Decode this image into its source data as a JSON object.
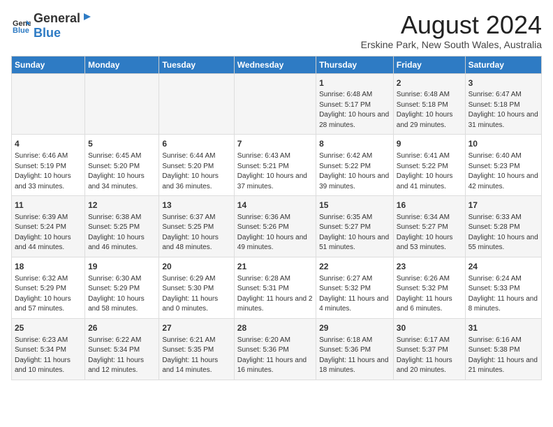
{
  "logo": {
    "text_general": "General",
    "text_blue": "Blue"
  },
  "title": "August 2024",
  "subtitle": "Erskine Park, New South Wales, Australia",
  "days_of_week": [
    "Sunday",
    "Monday",
    "Tuesday",
    "Wednesday",
    "Thursday",
    "Friday",
    "Saturday"
  ],
  "weeks": [
    [
      {
        "day": "",
        "content": ""
      },
      {
        "day": "",
        "content": ""
      },
      {
        "day": "",
        "content": ""
      },
      {
        "day": "",
        "content": ""
      },
      {
        "day": "1",
        "content": "Sunrise: 6:48 AM\nSunset: 5:17 PM\nDaylight: 10 hours and 28 minutes."
      },
      {
        "day": "2",
        "content": "Sunrise: 6:48 AM\nSunset: 5:18 PM\nDaylight: 10 hours and 29 minutes."
      },
      {
        "day": "3",
        "content": "Sunrise: 6:47 AM\nSunset: 5:18 PM\nDaylight: 10 hours and 31 minutes."
      }
    ],
    [
      {
        "day": "4",
        "content": "Sunrise: 6:46 AM\nSunset: 5:19 PM\nDaylight: 10 hours and 33 minutes."
      },
      {
        "day": "5",
        "content": "Sunrise: 6:45 AM\nSunset: 5:20 PM\nDaylight: 10 hours and 34 minutes."
      },
      {
        "day": "6",
        "content": "Sunrise: 6:44 AM\nSunset: 5:20 PM\nDaylight: 10 hours and 36 minutes."
      },
      {
        "day": "7",
        "content": "Sunrise: 6:43 AM\nSunset: 5:21 PM\nDaylight: 10 hours and 37 minutes."
      },
      {
        "day": "8",
        "content": "Sunrise: 6:42 AM\nSunset: 5:22 PM\nDaylight: 10 hours and 39 minutes."
      },
      {
        "day": "9",
        "content": "Sunrise: 6:41 AM\nSunset: 5:22 PM\nDaylight: 10 hours and 41 minutes."
      },
      {
        "day": "10",
        "content": "Sunrise: 6:40 AM\nSunset: 5:23 PM\nDaylight: 10 hours and 42 minutes."
      }
    ],
    [
      {
        "day": "11",
        "content": "Sunrise: 6:39 AM\nSunset: 5:24 PM\nDaylight: 10 hours and 44 minutes."
      },
      {
        "day": "12",
        "content": "Sunrise: 6:38 AM\nSunset: 5:25 PM\nDaylight: 10 hours and 46 minutes."
      },
      {
        "day": "13",
        "content": "Sunrise: 6:37 AM\nSunset: 5:25 PM\nDaylight: 10 hours and 48 minutes."
      },
      {
        "day": "14",
        "content": "Sunrise: 6:36 AM\nSunset: 5:26 PM\nDaylight: 10 hours and 49 minutes."
      },
      {
        "day": "15",
        "content": "Sunrise: 6:35 AM\nSunset: 5:27 PM\nDaylight: 10 hours and 51 minutes."
      },
      {
        "day": "16",
        "content": "Sunrise: 6:34 AM\nSunset: 5:27 PM\nDaylight: 10 hours and 53 minutes."
      },
      {
        "day": "17",
        "content": "Sunrise: 6:33 AM\nSunset: 5:28 PM\nDaylight: 10 hours and 55 minutes."
      }
    ],
    [
      {
        "day": "18",
        "content": "Sunrise: 6:32 AM\nSunset: 5:29 PM\nDaylight: 10 hours and 57 minutes."
      },
      {
        "day": "19",
        "content": "Sunrise: 6:30 AM\nSunset: 5:29 PM\nDaylight: 10 hours and 58 minutes."
      },
      {
        "day": "20",
        "content": "Sunrise: 6:29 AM\nSunset: 5:30 PM\nDaylight: 11 hours and 0 minutes."
      },
      {
        "day": "21",
        "content": "Sunrise: 6:28 AM\nSunset: 5:31 PM\nDaylight: 11 hours and 2 minutes."
      },
      {
        "day": "22",
        "content": "Sunrise: 6:27 AM\nSunset: 5:32 PM\nDaylight: 11 hours and 4 minutes."
      },
      {
        "day": "23",
        "content": "Sunrise: 6:26 AM\nSunset: 5:32 PM\nDaylight: 11 hours and 6 minutes."
      },
      {
        "day": "24",
        "content": "Sunrise: 6:24 AM\nSunset: 5:33 PM\nDaylight: 11 hours and 8 minutes."
      }
    ],
    [
      {
        "day": "25",
        "content": "Sunrise: 6:23 AM\nSunset: 5:34 PM\nDaylight: 11 hours and 10 minutes."
      },
      {
        "day": "26",
        "content": "Sunrise: 6:22 AM\nSunset: 5:34 PM\nDaylight: 11 hours and 12 minutes."
      },
      {
        "day": "27",
        "content": "Sunrise: 6:21 AM\nSunset: 5:35 PM\nDaylight: 11 hours and 14 minutes."
      },
      {
        "day": "28",
        "content": "Sunrise: 6:20 AM\nSunset: 5:36 PM\nDaylight: 11 hours and 16 minutes."
      },
      {
        "day": "29",
        "content": "Sunrise: 6:18 AM\nSunset: 5:36 PM\nDaylight: 11 hours and 18 minutes."
      },
      {
        "day": "30",
        "content": "Sunrise: 6:17 AM\nSunset: 5:37 PM\nDaylight: 11 hours and 20 minutes."
      },
      {
        "day": "31",
        "content": "Sunrise: 6:16 AM\nSunset: 5:38 PM\nDaylight: 11 hours and 21 minutes."
      }
    ]
  ]
}
